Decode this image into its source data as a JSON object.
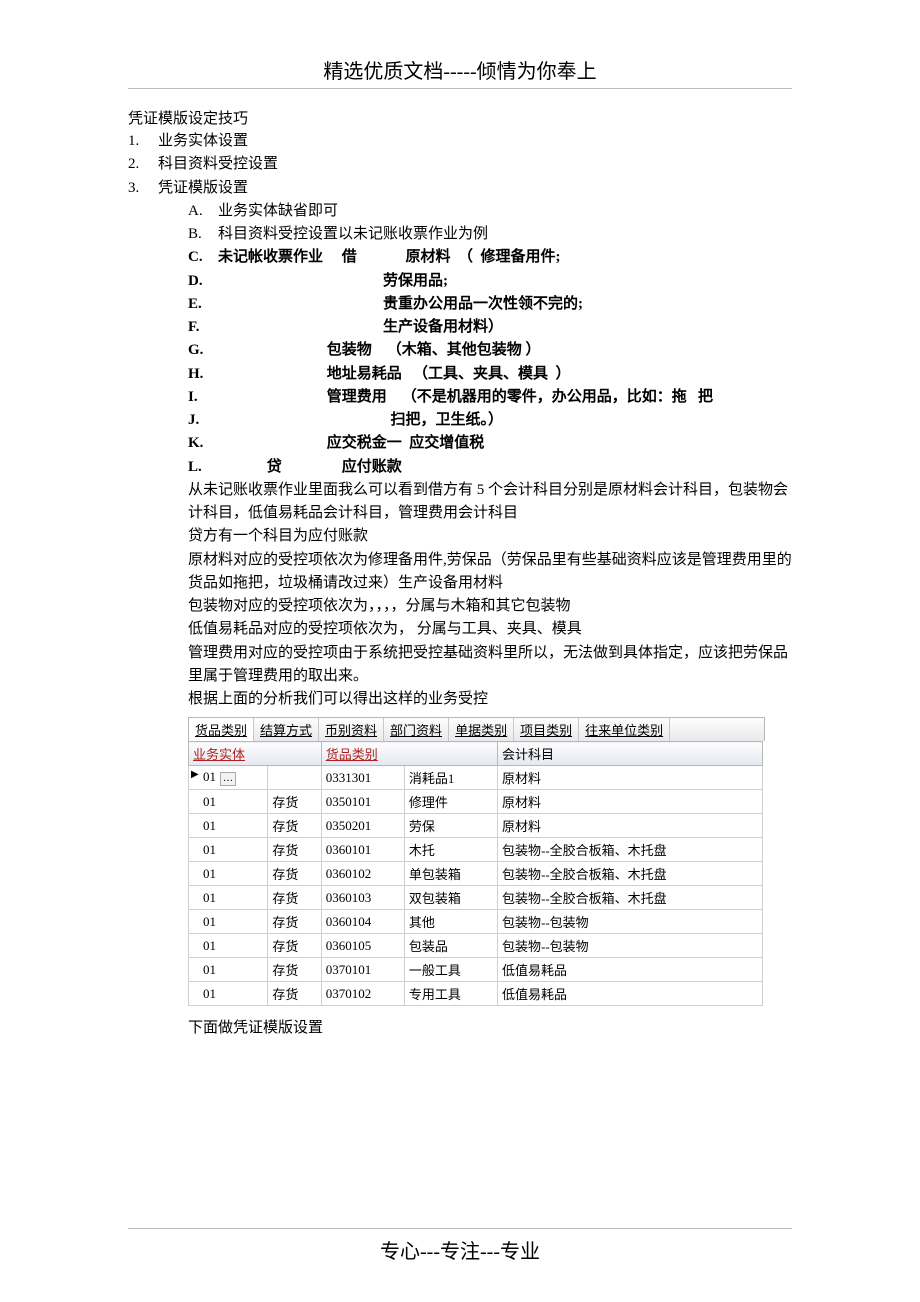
{
  "header": "精选优质文档-----倾情为你奉上",
  "title": "凭证模版设定技巧",
  "numbered": [
    "业务实体设置",
    "科目资料受控设置",
    "凭证模版设置"
  ],
  "subitems": {
    "A": "业务实体缺省即可",
    "B": "科目资料受控设置以未记账收票作业为例",
    "C": "未记帐收票作业     借             原材料  （  修理备用件;",
    "D": "                                            劳保用品;",
    "E": "                                            贵重办公用品一次性领不完的;",
    "F": "                                            生产设备用材料）",
    "G": "                             包装物    （木箱、其他包装物 ）",
    "H": "                             地址易耗品   （工具、夹具、模具  ）",
    "I": "                             管理费用    （不是机器用的零件，办公用品，比如：拖   把",
    "J": "                                              扫把，卫生纸。）",
    "K": "                             应交税金一  应交增值税",
    "L": "             贷                应付账款"
  },
  "paragraphs": [
    "从未记账收票作业里面我么可以看到借方有 5 个会计科目分别是原材料会计科目，包装物会计科目，低值易耗品会计科目，管理费用会计科目",
    "贷方有一个科目为应付账款",
    "原材料对应的受控项依次为修理备用件,劳保品（劳保品里有些基础资料应该是管理费用里的货品如拖把，垃圾桶请改过来）生产设备用材料",
    "包装物对应的受控项依次为，，，，分属与木箱和其它包装物",
    "低值易耗品对应的受控项依次为， 分属与工具、夹具、模具",
    "管理费用对应的受控项由于系统把受控基础资料里所以，无法做到具体指定，应该把劳保品里属于管理费用的取出来。",
    "根据上面的分析我们可以得出这样的业务受控"
  ],
  "tabs": [
    "货品类别",
    "结算方式",
    "币别资料",
    "部门资料",
    "单据类别",
    "项目类别",
    "往来单位类别"
  ],
  "cols": {
    "c1": "业务实体",
    "c2": "货品类别",
    "c3": "会计科目"
  },
  "rows": [
    {
      "a": "01",
      "a2": "",
      "b1": "0331301",
      "b2": "消耗品1",
      "c": "原材料",
      "ptr": true,
      "ell": true
    },
    {
      "a": "01",
      "a2": "存货",
      "b1": "0350101",
      "b2": "修理件",
      "c": "原材料"
    },
    {
      "a": "01",
      "a2": "存货",
      "b1": "0350201",
      "b2": "劳保",
      "c": "原材料"
    },
    {
      "a": "01",
      "a2": "存货",
      "b1": "0360101",
      "b2": "木托",
      "c": "包装物--全胶合板箱、木托盘"
    },
    {
      "a": "01",
      "a2": "存货",
      "b1": "0360102",
      "b2": "单包装箱",
      "c": "包装物--全胶合板箱、木托盘"
    },
    {
      "a": "01",
      "a2": "存货",
      "b1": "0360103",
      "b2": "双包装箱",
      "c": "包装物--全胶合板箱、木托盘"
    },
    {
      "a": "01",
      "a2": "存货",
      "b1": "0360104",
      "b2": "其他",
      "c": "包装物--包装物"
    },
    {
      "a": "01",
      "a2": "存货",
      "b1": "0360105",
      "b2": "包装品",
      "c": "包装物--包装物"
    },
    {
      "a": "01",
      "a2": "存货",
      "b1": "0370101",
      "b2": "一般工具",
      "c": "低值易耗品"
    },
    {
      "a": "01",
      "a2": "存货",
      "b1": "0370102",
      "b2": "专用工具",
      "c": "低值易耗品"
    }
  ],
  "after_table": "下面做凭证模版设置",
  "footer": "专心---专注---专业"
}
